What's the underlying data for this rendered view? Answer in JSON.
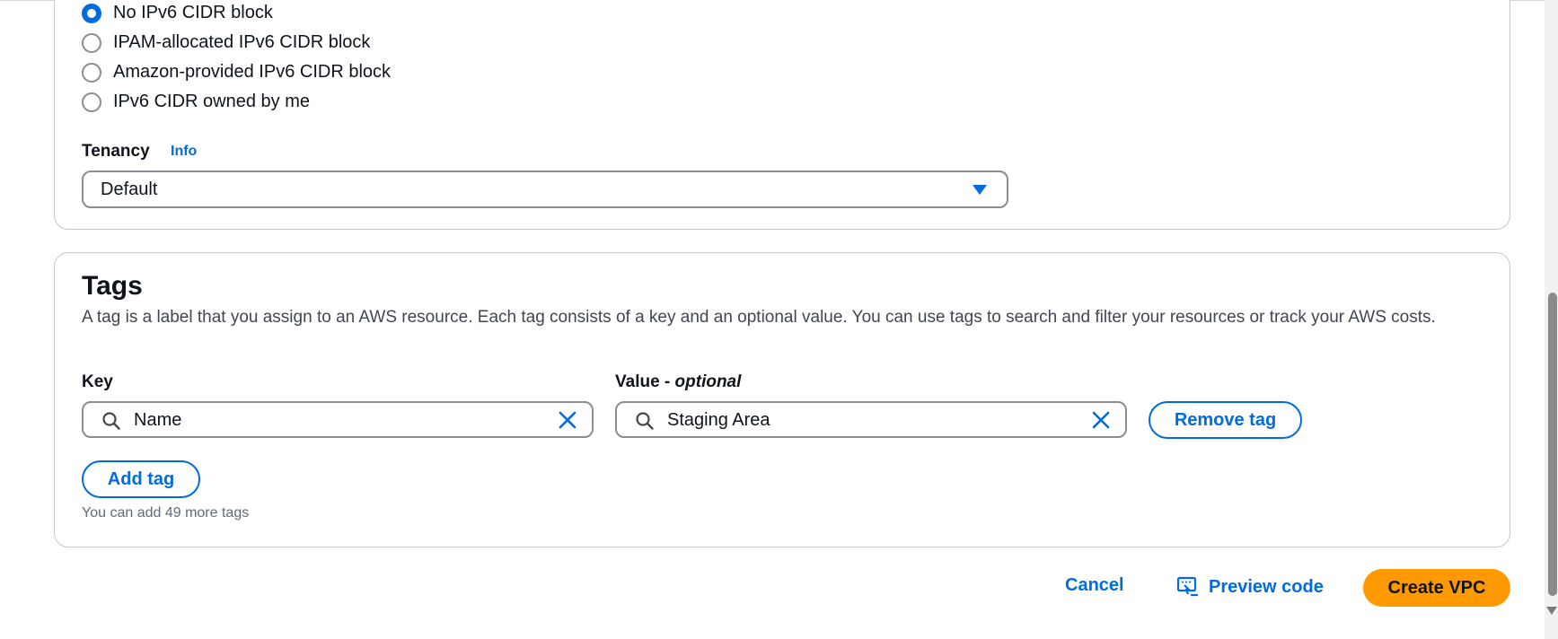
{
  "ipv6": {
    "options": [
      {
        "label": "No IPv6 CIDR block",
        "checked": true
      },
      {
        "label": "IPAM-allocated IPv6 CIDR block",
        "checked": false
      },
      {
        "label": "Amazon-provided IPv6 CIDR block",
        "checked": false
      },
      {
        "label": "IPv6 CIDR owned by me",
        "checked": false
      }
    ]
  },
  "tenancy": {
    "label": "Tenancy",
    "info": "Info",
    "selected": "Default"
  },
  "tags": {
    "title": "Tags",
    "description": "A tag is a label that you assign to an AWS resource. Each tag consists of a key and an optional value. You can use tags to search and filter your resources or track your AWS costs.",
    "key_label": "Key",
    "value_label": "Value - ",
    "value_optional": "optional",
    "rows": [
      {
        "key": "Name",
        "value": "Staging Area"
      }
    ],
    "remove_label": "Remove tag",
    "add_label": "Add tag",
    "hint": "You can add 49 more tags"
  },
  "footer": {
    "cancel": "Cancel",
    "preview": "Preview code",
    "create": "Create VPC"
  },
  "colors": {
    "accent": "#006ce0",
    "primary_button": "#ff9900",
    "border": "#8c8c94"
  },
  "icons": {
    "search": "search-icon",
    "clear": "close-icon",
    "preview": "code-preview-icon",
    "dropdown": "caret-down-icon"
  }
}
